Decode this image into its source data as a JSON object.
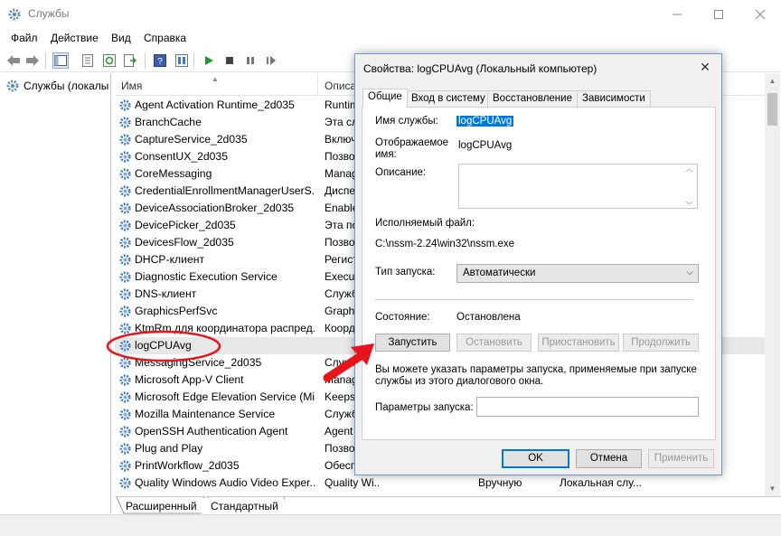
{
  "window": {
    "title": "Службы"
  },
  "menu": [
    "Файл",
    "Действие",
    "Вид",
    "Справка"
  ],
  "left_pane": {
    "tree_item": "Службы (локалы"
  },
  "columns": {
    "name": "Имя",
    "description": "Описа"
  },
  "services": [
    {
      "name": "Agent Activation Runtime_2d035",
      "desc": "Runtim"
    },
    {
      "name": "BranchCache",
      "desc": "Эта сл"
    },
    {
      "name": "CaptureService_2d035",
      "desc": "Включ"
    },
    {
      "name": "ConsentUX_2d035",
      "desc": "Позво"
    },
    {
      "name": "CoreMessaging",
      "desc": "Manag"
    },
    {
      "name": "CredentialEnrollmentManagerUserS...",
      "desc": "Диспе"
    },
    {
      "name": "DeviceAssociationBroker_2d035",
      "desc": "Enable"
    },
    {
      "name": "DevicePicker_2d035",
      "desc": "Эта по"
    },
    {
      "name": "DevicesFlow_2d035",
      "desc": "Позво"
    },
    {
      "name": "DHCP-клиент",
      "desc": "Регист"
    },
    {
      "name": "Diagnostic Execution Service",
      "desc": "Execut"
    },
    {
      "name": "DNS-клиент",
      "desc": "Служб"
    },
    {
      "name": "GraphicsPerfSvc",
      "desc": "Graphi"
    },
    {
      "name": "KtmRm для координатора распред...",
      "desc": "Коорд"
    },
    {
      "name": "logCPUAvg",
      "desc": ""
    },
    {
      "name": "MessagingService_2d035",
      "desc": "Служб"
    },
    {
      "name": "Microsoft App-V Client",
      "desc": "Manag"
    },
    {
      "name": "Microsoft Edge Elevation Service (Mi...",
      "desc": "Keeps"
    },
    {
      "name": "Mozilla Maintenance Service",
      "desc": "Служб"
    },
    {
      "name": "OpenSSH Authentication Agent",
      "desc": "Agent"
    },
    {
      "name": "Plug and Play",
      "desc": "Позво"
    },
    {
      "name": "PrintWorkflow_2d035",
      "desc": "Обесп"
    },
    {
      "name": "Quality Windows Audio Video Exper...",
      "desc": "Quality Wi...",
      "startup": "Вручную",
      "logon": "Локальная слу..."
    }
  ],
  "bottom_tabs": {
    "extended": "Расширенный",
    "standard": "Стандартный"
  },
  "dialog": {
    "title": "Свойства: logCPUAvg (Локальный компьютер)",
    "close": "✕",
    "tabs": [
      "Общие",
      "Вход в систему",
      "Восстановление",
      "Зависимости"
    ],
    "service_name_label": "Имя службы:",
    "service_name": "logCPUAvg",
    "display_name_label": "Отображаемое имя:",
    "display_name": "logCPUAvg",
    "description_label": "Описание:",
    "exe_label": "Исполняемый файл:",
    "exe_path": "C:\\nssm-2.24\\win32\\nssm.exe",
    "startup_label": "Тип запуска:",
    "startup_value": "Автоматически",
    "status_label": "Состояние:",
    "status_value": "Остановлена",
    "buttons": {
      "start": "Запустить",
      "stop": "Остановить",
      "pause": "Приостановить",
      "resume": "Продолжить"
    },
    "hint": "Вы можете указать параметры запуска, применяемые при запуске службы из этого диалогового окна.",
    "params_label": "Параметры запуска:",
    "params_value": "",
    "ok": "OK",
    "cancel": "Отмена",
    "apply": "Применить"
  },
  "colors": {
    "selection": "#0078d7",
    "annotation_red": "#e8141c",
    "gear_blue": "#3a7bc8",
    "dialog_border": "#6b9bd1"
  },
  "icons": [
    "gear-icon",
    "back-arrow-icon",
    "forward-arrow-icon",
    "play-icon",
    "stop-icon",
    "pause-icon",
    "restart-icon",
    "help-icon",
    "close-icon",
    "minimize-icon",
    "maximize-icon"
  ]
}
